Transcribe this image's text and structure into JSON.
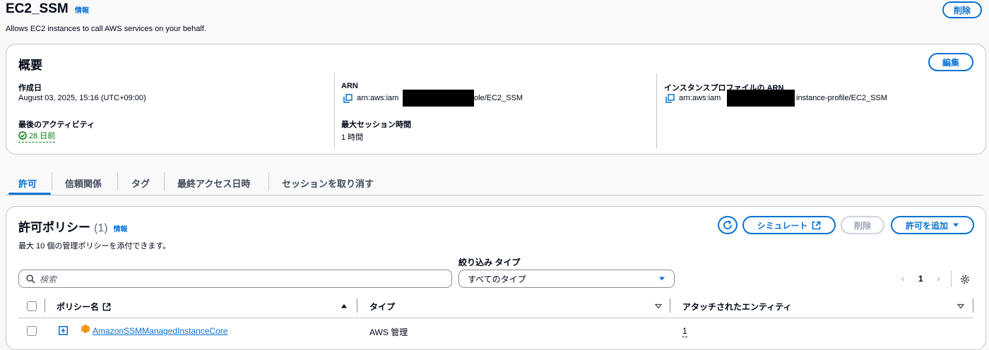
{
  "header": {
    "title": "EC2_SSM",
    "info": "情報",
    "description": "Allows EC2 instances to call AWS services on your behalf.",
    "delete_label": "削除"
  },
  "summary": {
    "heading": "概要",
    "edit_label": "編集",
    "created_label": "作成日",
    "created_value": "August 03, 2025, 15:16 (UTC+09:00)",
    "last_activity_label": "最後のアクティビティ",
    "last_activity_value": "28 日前",
    "arn_label": "ARN",
    "arn_prefix": "arn:aws:iam",
    "arn_suffix": "ole/EC2_SSM",
    "max_session_label": "最大セッション時間",
    "max_session_value": "1 時間",
    "instance_profile_label": "インスタンスプロファイルの ARN",
    "instance_profile_prefix": "arn:aws:iam",
    "instance_profile_suffix": "instance-profile/EC2_SSM"
  },
  "tabs": [
    {
      "label": "許可",
      "active": true
    },
    {
      "label": "信頼関係",
      "active": false
    },
    {
      "label": "タグ",
      "active": false
    },
    {
      "label": "最終アクセス日時",
      "active": false
    },
    {
      "label": "セッションを取り消す",
      "active": false
    }
  ],
  "policies": {
    "heading": "許可ポリシー",
    "count": "(1)",
    "info": "情報",
    "subtitle": "最大 10 個の管理ポリシーを添付できます。",
    "simulate_label": "シミュレート",
    "delete_label": "削除",
    "add_label": "許可を追加",
    "search_placeholder": "検索",
    "filter_label": "絞り込み タイプ",
    "filter_value": "すべてのタイプ",
    "page_number": "1",
    "columns": {
      "name": "ポリシー名",
      "type": "タイプ",
      "entities": "アタッチされたエンティティ"
    },
    "rows": [
      {
        "name": "AmazonSSMManagedInstanceCore",
        "type": "AWS 管理",
        "entities": "1"
      }
    ]
  },
  "colors": {
    "accent": "#0972d3",
    "success": "#037f0c",
    "policy_icon": "#f89c1c"
  }
}
